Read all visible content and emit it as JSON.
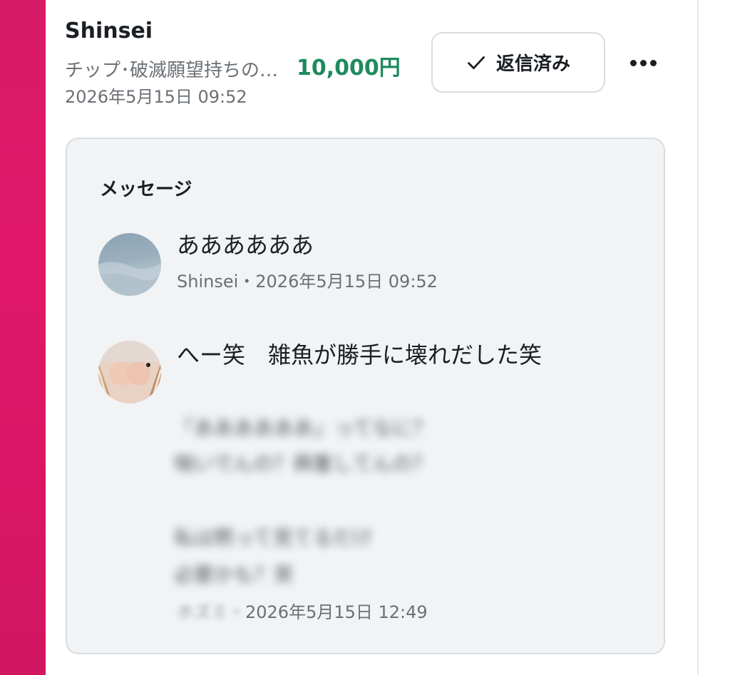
{
  "header": {
    "name": "Shinsei",
    "subtitle": "チップ･破滅願望持ちの…",
    "datetime": "2026年5月15日 09:52",
    "amount": "10,000円",
    "replied_label": "返信済み"
  },
  "message_card": {
    "title": "メッセージ",
    "messages": [
      {
        "text": "ああああああ",
        "meta": "Shinsei・2026年5月15日 09:52"
      },
      {
        "text": "へー笑　雑魚が勝手に壊れだした笑",
        "blurred_lines": [
          "「ああああああ」ってなに？",
          "喘いでんの？興奮してんの？",
          "私は黙って見てるだけ",
          "必要かも？笑"
        ],
        "meta_blurred": "ホズミ・",
        "meta_visible": "2026年5月15日 12:49"
      }
    ]
  },
  "colors": {
    "accent_bar": "#d81b66",
    "amount": "#1f8a5e"
  },
  "icons": {
    "check": "check-icon",
    "more": "more-horizontal-icon"
  }
}
